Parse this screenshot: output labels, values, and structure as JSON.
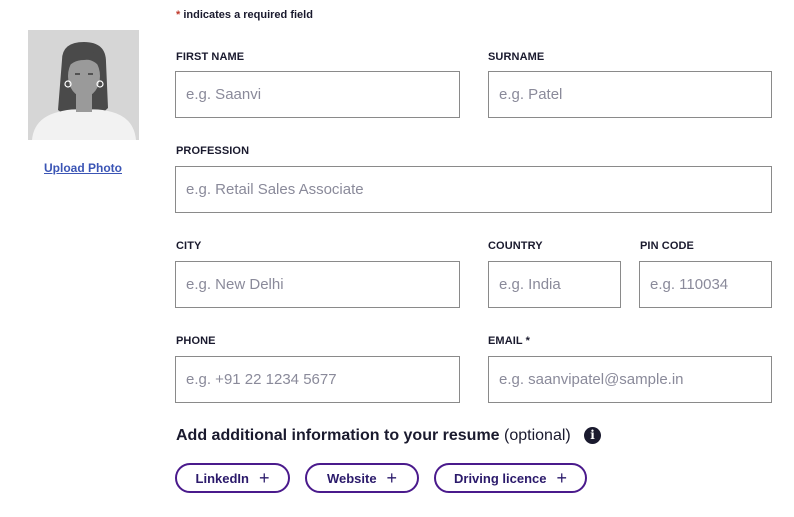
{
  "form": {
    "required_star": "*",
    "required_note": " indicates a required field",
    "upload_photo": "Upload Photo",
    "fields": {
      "first_name": {
        "label": "FIRST NAME",
        "placeholder": "e.g. Saanvi"
      },
      "surname": {
        "label": "SURNAME",
        "placeholder": "e.g. Patel"
      },
      "profession": {
        "label": "PROFESSION",
        "placeholder": "e.g. Retail Sales Associate"
      },
      "city": {
        "label": "CITY",
        "placeholder": "e.g. New Delhi"
      },
      "country": {
        "label": "COUNTRY",
        "placeholder": "e.g. India"
      },
      "pin_code": {
        "label": "PIN CODE",
        "placeholder": "e.g. 110034"
      },
      "phone": {
        "label": "PHONE",
        "placeholder": "e.g. +91 22 1234 5677"
      },
      "email": {
        "label": "EMAIL",
        "required_mark": " *",
        "placeholder": "e.g. saanvipatel@sample.in"
      }
    },
    "additional": {
      "title": "Add additional information to your resume",
      "optional": " (optional)",
      "info_icon": "info-icon",
      "buttons": [
        {
          "label": "LinkedIn",
          "icon": "+"
        },
        {
          "label": "Website",
          "icon": "+"
        },
        {
          "label": "Driving licence",
          "icon": "+"
        }
      ]
    }
  },
  "colors": {
    "text": "#1a1a2e",
    "link": "#3b55b5",
    "pill_border": "#4a1a8c",
    "input_border": "#8a8a8a",
    "photo_bg": "#d6d6d6"
  }
}
